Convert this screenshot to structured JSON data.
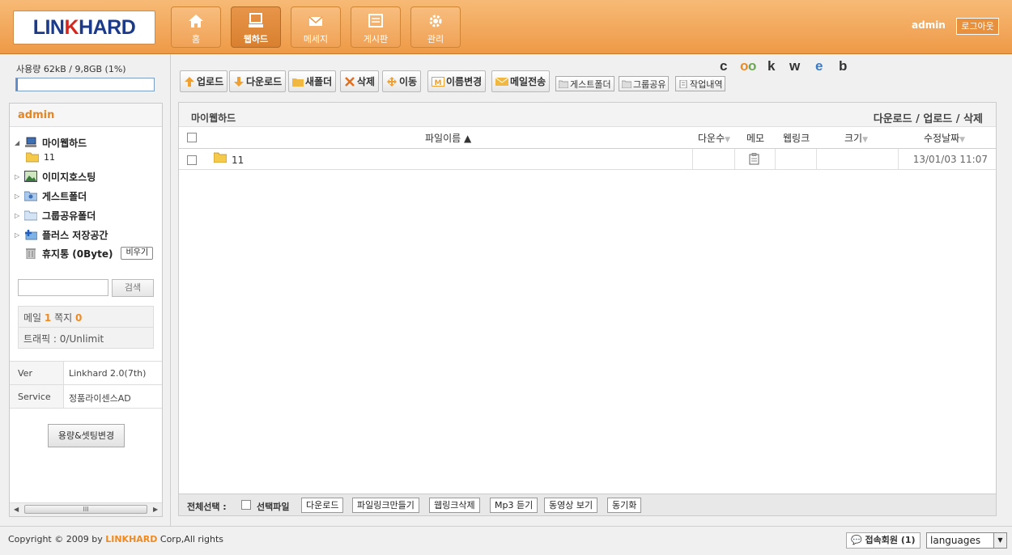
{
  "header": {
    "logo": {
      "part1": "LIN",
      "part2": "K",
      "part3": "HARD"
    },
    "nav": [
      {
        "label": "홈",
        "icon": "home-icon"
      },
      {
        "label": "웹하드",
        "icon": "monitor-icon",
        "active": true
      },
      {
        "label": "메세지",
        "icon": "message-icon"
      },
      {
        "label": "게시판",
        "icon": "board-icon"
      },
      {
        "label": "관리",
        "icon": "gear-icon"
      }
    ],
    "user": "admin",
    "logout_label": "로그아웃"
  },
  "sidebar": {
    "usage_text": "사용량 62kB / 9,8GB (1%)",
    "usage_percent": 1,
    "user": "admin",
    "tree": [
      {
        "label": "마이웹하드",
        "icon": "my-webhard-icon",
        "expanded": true
      },
      {
        "label": "11",
        "icon": "folder-icon"
      },
      {
        "label": "이미지호스팅",
        "icon": "image-hosting-icon"
      },
      {
        "label": "게스트폴더",
        "icon": "guest-folder-icon"
      },
      {
        "label": "그룹공유폴더",
        "icon": "group-folder-icon"
      },
      {
        "label": "플러스 저장공간",
        "icon": "plus-storage-icon"
      },
      {
        "label": "휴지통 (0Byte)",
        "icon": "trash-icon"
      }
    ],
    "empty_label": "비우기",
    "search_value": "",
    "search_label": "검색",
    "mail_label": "메일",
    "mail_count": "1",
    "note_label": "쪽지",
    "note_count": "0",
    "traffic": "트래픽 : 0/Unlimit",
    "ver_key": "Ver",
    "ver_value": "Linkhard 2.0(7th)",
    "service_key": "Service",
    "service_value": "정품라이센스AD",
    "settings_label": "용량&셋팅변경",
    "scroll_mark": "III"
  },
  "toolbar": {
    "upload": "업로드",
    "download": "다운로드",
    "new_folder": "새폴더",
    "delete": "삭제",
    "move": "이동",
    "rename": "이름변경",
    "email": "메일전송",
    "guest_folder": "게스트폴더",
    "group_share": "그룹공유",
    "history": "작업내역"
  },
  "cookweb": {
    "c": "c",
    "o1": "o",
    "o2": "o",
    "k": "k",
    "w": "w",
    "e": "e",
    "b": "b",
    "colors": {
      "dark": "#333333",
      "orange": "#f08a1f",
      "green": "#6aa84f",
      "blue": "#3d7ac6"
    }
  },
  "main": {
    "title": "마이웹하드",
    "links": "다운로드 / 업로드 / 삭제",
    "columns": {
      "name": "파일이름 ▲",
      "downloads": "다운수",
      "memo": "메모",
      "weblink": "웹링크",
      "size": "크기",
      "modified": "수정날짜"
    },
    "rows": [
      {
        "name": "11",
        "downloads": "",
        "weblink": "",
        "size": "",
        "modified": "13/01/03 11:07"
      }
    ],
    "bottom": {
      "select_all": "전체선택 :",
      "selected_files": "선택파일",
      "buttons": [
        "다운로드",
        "파일링크만들기",
        "웹링크삭제",
        "Mp3 듣기",
        "동영상 보기",
        "동기화"
      ]
    }
  },
  "footer": {
    "copyright_pre": "Copyright © 2009 by",
    "brand": "LINKHARD",
    "copyright_post": "Corp,All rights",
    "online": "접속회원 (1)",
    "language": "languages"
  },
  "colors": {
    "accent": "#ee9a47",
    "brand_blue": "#1b3a8a",
    "brand_red": "#d7261e",
    "highlight": "#f08a1f"
  }
}
